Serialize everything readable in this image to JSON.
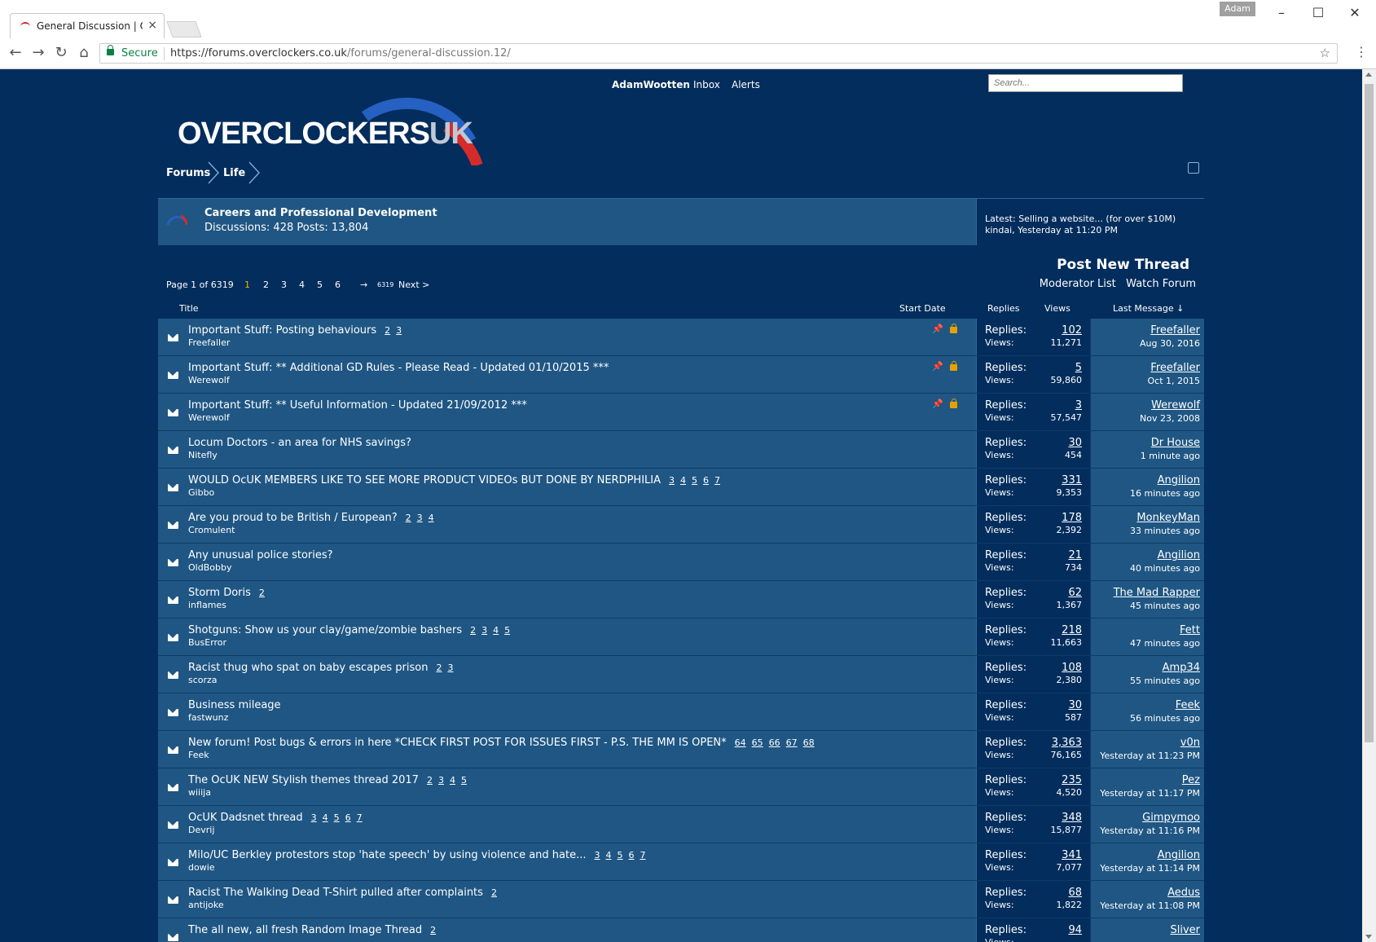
{
  "browser": {
    "tab_title": "General Discussion | Ove",
    "profile": "Adam",
    "secure_label": "Secure",
    "url_host": "https://forums.overclockers.co.uk",
    "url_path": "/forums/general-discussion.12/"
  },
  "header": {
    "user": "AdamWootten",
    "inbox": "Inbox",
    "alerts": "Alerts",
    "search_placeholder": "Search...",
    "logo_main": "OVERCLOCKERS",
    "logo_suffix": "UK"
  },
  "breadcrumb": [
    "Forums",
    "Life"
  ],
  "forum": {
    "name": "Careers and Professional Development",
    "stats": "Discussions: 428 Posts: 13,804",
    "latest_line1": "Latest: Selling a website... (for over $10M)",
    "latest_line2": "kindai, Yesterday at 11:20 PM"
  },
  "actions": {
    "post_new_thread": "Post New Thread",
    "moderator_list": "Moderator List",
    "watch_forum": "Watch Forum"
  },
  "pagenav": {
    "label": "Page 1 of 6319",
    "current": "1",
    "pages": [
      "2",
      "3",
      "4",
      "5",
      "6"
    ],
    "arrow": "→",
    "last": "6319",
    "next": "Next >"
  },
  "columns": {
    "title": "Title",
    "start_date": "Start Date",
    "replies": "Replies",
    "views": "Views",
    "last_message": "Last Message ↓"
  },
  "stat_labels": {
    "replies": "Replies:",
    "views": "Views:"
  },
  "threads": [
    {
      "title": "Important Stuff: Posting behaviours",
      "pages": "2 3",
      "author": "Freefaller",
      "sticky": true,
      "replies": "102",
      "views": "11,271",
      "last_user": "Freefaller",
      "last_time": "Aug 30, 2016"
    },
    {
      "title": "Important Stuff: ** Additional GD Rules - Please Read - Updated 01/10/2015 ***",
      "pages": "",
      "author": "Werewolf",
      "sticky": true,
      "replies": "5",
      "views": "59,860",
      "last_user": "Freefaller",
      "last_time": "Oct 1, 2015"
    },
    {
      "title": "Important Stuff: ** Useful Information - Updated 21/09/2012 ***",
      "pages": "",
      "author": "Werewolf",
      "sticky": true,
      "replies": "3",
      "views": "57,547",
      "last_user": "Werewolf",
      "last_time": "Nov 23, 2008"
    },
    {
      "title": "Locum Doctors - an area for NHS savings?",
      "pages": "",
      "author": "Nitefly",
      "sticky": false,
      "replies": "30",
      "views": "454",
      "last_user": "Dr House",
      "last_time": "1 minute ago"
    },
    {
      "title": "WOULD OcUK MEMBERS LIKE TO SEE MORE PRODUCT VIDEOs BUT DONE BY NERDPHILIA",
      "pages": "3 4 5 6 7",
      "author": "Gibbo",
      "sticky": false,
      "replies": "331",
      "views": "9,353",
      "last_user": "Angilion",
      "last_time": "16 minutes ago"
    },
    {
      "title": "Are you proud to be British / European?",
      "pages": "2 3 4",
      "author": "Cromulent",
      "sticky": false,
      "replies": "178",
      "views": "2,392",
      "last_user": "MonkeyMan",
      "last_time": "33 minutes ago"
    },
    {
      "title": "Any unusual police stories?",
      "pages": "",
      "author": "OldBobby",
      "sticky": false,
      "replies": "21",
      "views": "734",
      "last_user": "Angilion",
      "last_time": "40 minutes ago"
    },
    {
      "title": "Storm Doris",
      "pages": "2",
      "author": "inflames",
      "sticky": false,
      "replies": "62",
      "views": "1,367",
      "last_user": "The Mad Rapper",
      "last_time": "45 minutes ago"
    },
    {
      "title": "Shotguns: Show us your clay/game/zombie bashers",
      "pages": "2 3 4 5",
      "author": "BusError",
      "sticky": false,
      "replies": "218",
      "views": "11,663",
      "last_user": "Fett",
      "last_time": "47 minutes ago"
    },
    {
      "title": "Racist thug who spat on baby escapes prison",
      "pages": "2 3",
      "author": "scorza",
      "sticky": false,
      "replies": "108",
      "views": "2,380",
      "last_user": "Amp34",
      "last_time": "55 minutes ago"
    },
    {
      "title": "Business mileage",
      "pages": "",
      "author": "fastwunz",
      "sticky": false,
      "replies": "30",
      "views": "587",
      "last_user": "Feek",
      "last_time": "56 minutes ago"
    },
    {
      "title": "New forum! Post bugs & errors in here *CHECK FIRST POST FOR ISSUES FIRST - P.S. THE MM IS OPEN*",
      "pages": "64 65 66 67 68",
      "author": "Feek",
      "sticky": false,
      "replies": "3,363",
      "views": "76,165",
      "last_user": "v0n",
      "last_time": "Yesterday at 11:23 PM"
    },
    {
      "title": "The OcUK NEW Stylish themes thread 2017",
      "pages": "2 3 4 5",
      "author": "wiiija",
      "sticky": false,
      "replies": "235",
      "views": "4,520",
      "last_user": "Pez",
      "last_time": "Yesterday at 11:17 PM"
    },
    {
      "title": "OcUK Dadsnet thread",
      "pages": "3 4 5 6 7",
      "author": "Devrij",
      "sticky": false,
      "replies": "348",
      "views": "15,877",
      "last_user": "Gimpymoo",
      "last_time": "Yesterday at 11:16 PM"
    },
    {
      "title": "Milo/UC Berkley protestors stop 'hate speech' by using violence and hate...",
      "pages": "3 4 5 6 7",
      "author": "dowie",
      "sticky": false,
      "replies": "341",
      "views": "7,077",
      "last_user": "Angilion",
      "last_time": "Yesterday at 11:14 PM"
    },
    {
      "title": "Racist The Walking Dead T-Shirt pulled after complaints",
      "pages": "2",
      "author": "antijoke",
      "sticky": false,
      "replies": "68",
      "views": "1,822",
      "last_user": "Aedus",
      "last_time": "Yesterday at 11:08 PM"
    },
    {
      "title": "The all new, all fresh Random Image Thread",
      "pages": "2",
      "author": "",
      "sticky": false,
      "replies": "94",
      "views": "",
      "last_user": "Sliver",
      "last_time": ""
    }
  ]
}
